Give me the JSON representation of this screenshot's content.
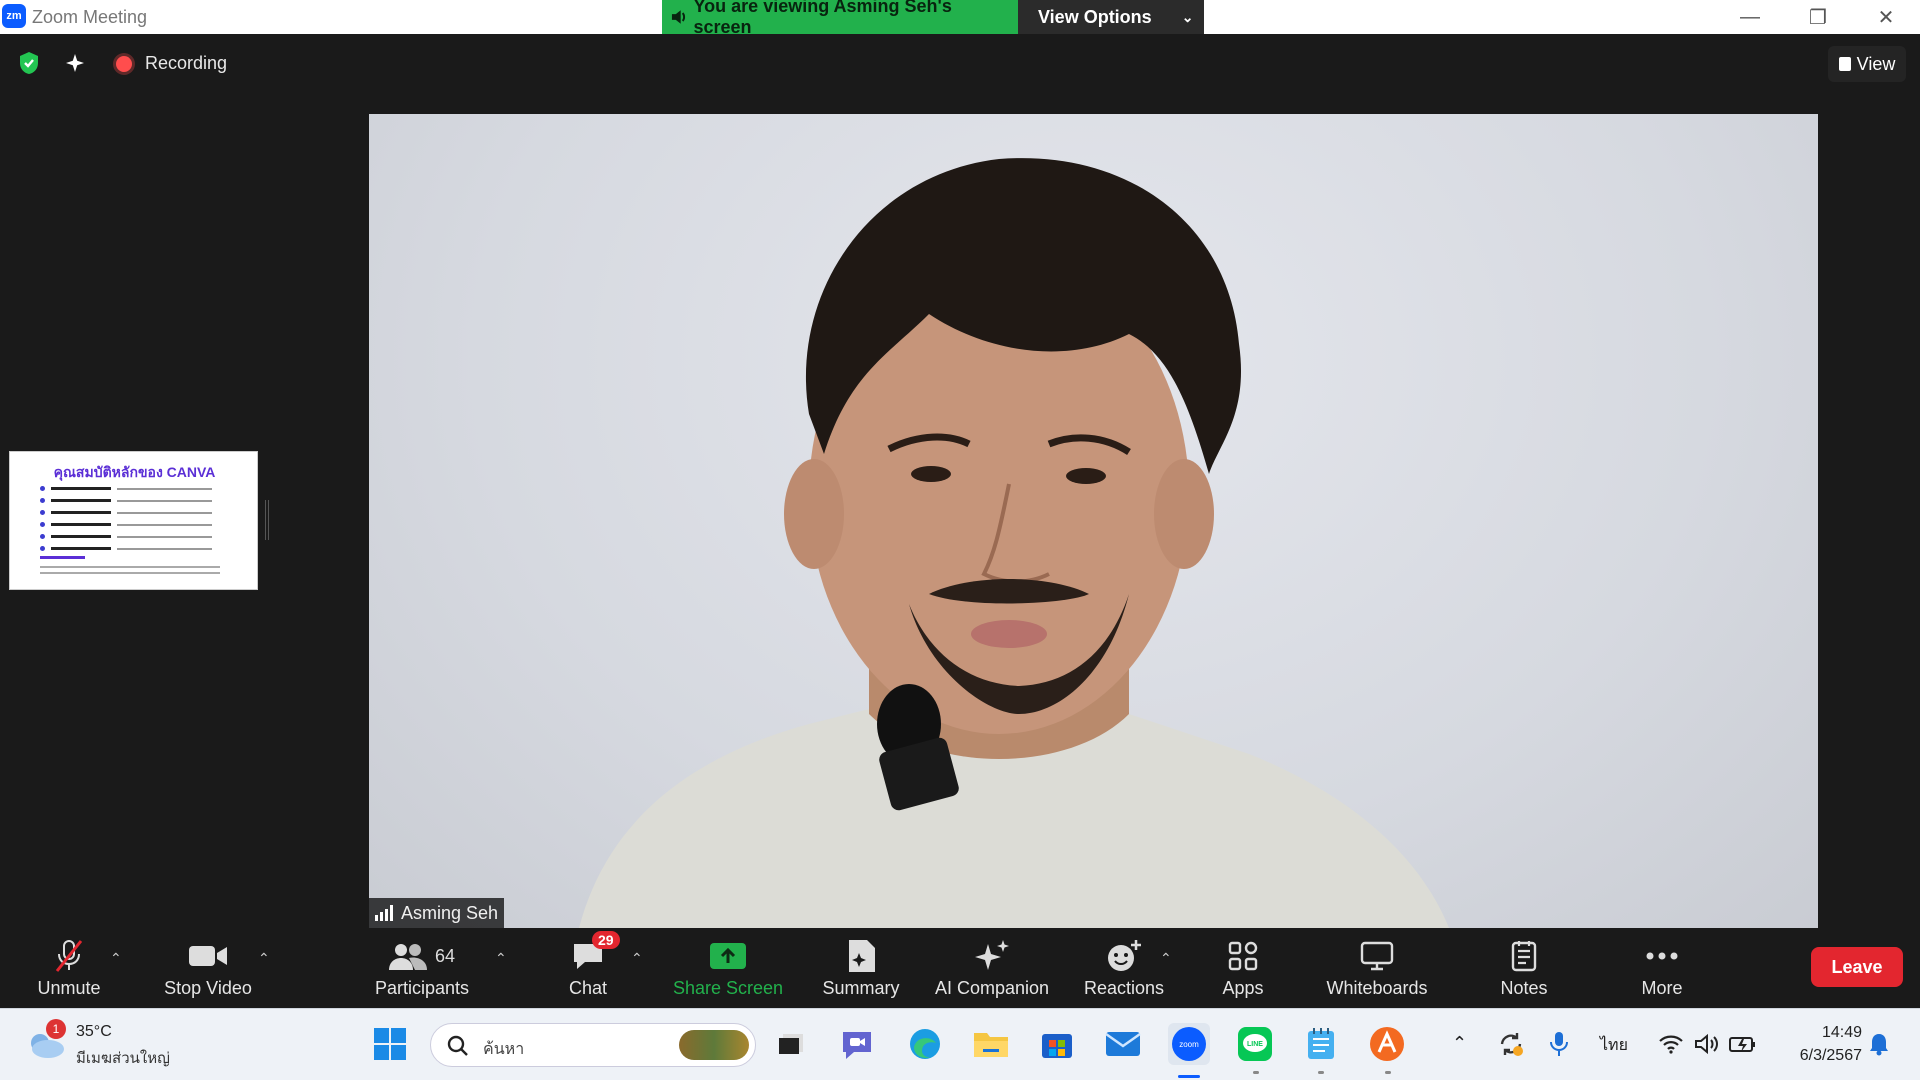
{
  "window": {
    "app_name": "Zoom Meeting",
    "logo_text": "zm"
  },
  "banner": {
    "viewing_text": "You are viewing Asming Seh's screen",
    "view_options_label": "View Options"
  },
  "topbar": {
    "recording_label": "Recording",
    "view_label": "View"
  },
  "video": {
    "participant_name": "Asming Seh"
  },
  "thumbnail": {
    "title": "คุณสมบัติหลักของ CANVA"
  },
  "toolbar": {
    "unmute": "Unmute",
    "stop_video": "Stop Video",
    "participants": "Participants",
    "participants_count": "64",
    "chat": "Chat",
    "chat_badge": "29",
    "share_screen": "Share Screen",
    "summary": "Summary",
    "ai_companion": "AI Companion",
    "reactions": "Reactions",
    "apps": "Apps",
    "whiteboards": "Whiteboards",
    "notes": "Notes",
    "more": "More",
    "leave": "Leave"
  },
  "taskbar": {
    "weather_temp": "35°C",
    "weather_desc": "มีเมฆส่วนใหญ่",
    "weather_badge": "1",
    "search_placeholder": "ค้นหา",
    "language": "ไทย",
    "time": "14:49",
    "date": "6/3/2567"
  },
  "colors": {
    "accent_green": "#22b14c",
    "leave_red": "#e3262f",
    "zoom_blue": "#0b5cff"
  }
}
